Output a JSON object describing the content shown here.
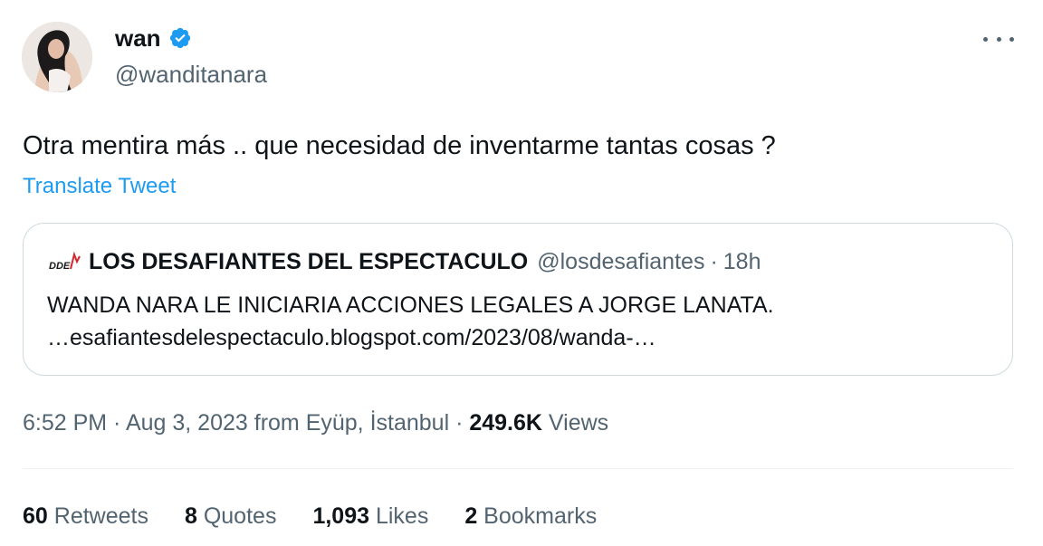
{
  "author": {
    "display_name": "wan",
    "handle": "@wanditanara",
    "verified_icon": "verified-badge-icon",
    "avatar_icon": "profile-photo"
  },
  "tweet": {
    "text": "Otra mentira más .. que necesidad de inventarme tantas cosas ?",
    "translate_label": "Translate Tweet"
  },
  "quoted": {
    "logo_text": "DDE",
    "name": "LOS DESAFIANTES DEL ESPECTACULO",
    "handle": "@losdesafiantes",
    "separator": "·",
    "time": "18h",
    "line1": "WANDA NARA LE INICIARIA ACCIONES LEGALES A JORGE LANATA.",
    "line2": "…esafiantesdelespectaculo.blogspot.com/2023/08/wanda-…"
  },
  "meta": {
    "time": "6:52 PM",
    "sep1": " · ",
    "date": "Aug 3, 2023",
    "location": " from Eyüp, İstanbul",
    "sep2": " · ",
    "views_count": "249.6K",
    "views_label": " Views"
  },
  "stats": {
    "retweets_count": "60",
    "retweets_label": " Retweets",
    "quotes_count": "8",
    "quotes_label": " Quotes",
    "likes_count": "1,093",
    "likes_label": " Likes",
    "bookmarks_count": "2",
    "bookmarks_label": " Bookmarks"
  },
  "colors": {
    "link_blue": "#1d9bf0",
    "secondary_text": "#536471",
    "primary_text": "#0f1419",
    "border": "#cfd9de"
  }
}
